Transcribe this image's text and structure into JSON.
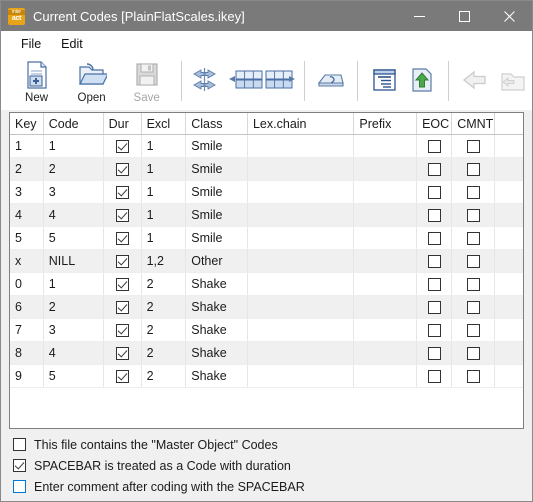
{
  "window": {
    "title": "Current Codes [PlainFlatScales.ikey]",
    "app_icon": "interact-app-icon",
    "app_icon_line1": "inter",
    "app_icon_line2": "act",
    "minimize_label": "Minimize",
    "maximize_label": "Maximize",
    "close_label": "Close",
    "accent_icon_color": "#e8a317",
    "titlebar_color": "#7a7a7a"
  },
  "menubar": {
    "items": [
      {
        "label": "File"
      },
      {
        "label": "Edit"
      }
    ]
  },
  "toolbar": {
    "buttons": [
      {
        "label": "New",
        "icon": "new-document-icon",
        "enabled": true
      },
      {
        "label": "Open",
        "icon": "open-folder-icon",
        "enabled": true
      },
      {
        "label": "Save",
        "icon": "floppy-disk-save-icon",
        "enabled": false
      }
    ],
    "tools": [
      {
        "label": "",
        "icon": "move-columns-arrows-icon",
        "enabled": true
      },
      {
        "label": "",
        "icon": "insert-columns-icon",
        "enabled": true
      },
      {
        "label": "",
        "icon": "keyboard-key-icon",
        "enabled": true
      },
      {
        "label": "",
        "icon": "list-properties-icon",
        "enabled": true
      },
      {
        "label": "",
        "icon": "export-up-arrow-icon",
        "enabled": true
      },
      {
        "label": "",
        "icon": "back-arrow-icon",
        "enabled": false
      },
      {
        "label": "",
        "icon": "folder-back-icon",
        "enabled": false
      }
    ]
  },
  "grid": {
    "columns": [
      {
        "label": "Key",
        "width": "7.0%"
      },
      {
        "label": "Code",
        "width": "12.6%"
      },
      {
        "label": "Dur",
        "width": "8.0%"
      },
      {
        "label": "Excl",
        "width": "9.4%"
      },
      {
        "label": "Class",
        "width": "13.0%"
      },
      {
        "label": "Lex.chain",
        "width": "22.4%"
      },
      {
        "label": "Prefix",
        "width": "13.2%"
      },
      {
        "label": "EOC",
        "width": "7.4%"
      },
      {
        "label": "CMNT",
        "width": "9.0%"
      },
      {
        "label": "",
        "width": "6.0%"
      }
    ],
    "rows": [
      {
        "key": "1",
        "code": "1",
        "dur": true,
        "excl": "1",
        "class": "Smile",
        "lexchain": "",
        "prefix": "",
        "eoc": false,
        "cmnt": false
      },
      {
        "key": "2",
        "code": "2",
        "dur": true,
        "excl": "1",
        "class": "Smile",
        "lexchain": "",
        "prefix": "",
        "eoc": false,
        "cmnt": false
      },
      {
        "key": "3",
        "code": "3",
        "dur": true,
        "excl": "1",
        "class": "Smile",
        "lexchain": "",
        "prefix": "",
        "eoc": false,
        "cmnt": false
      },
      {
        "key": "4",
        "code": "4",
        "dur": true,
        "excl": "1",
        "class": "Smile",
        "lexchain": "",
        "prefix": "",
        "eoc": false,
        "cmnt": false
      },
      {
        "key": "5",
        "code": "5",
        "dur": true,
        "excl": "1",
        "class": "Smile",
        "lexchain": "",
        "prefix": "",
        "eoc": false,
        "cmnt": false
      },
      {
        "key": "x",
        "code": "NILL",
        "dur": true,
        "excl": "1,2",
        "class": "Other",
        "lexchain": "",
        "prefix": "",
        "eoc": false,
        "cmnt": false
      },
      {
        "key": "0",
        "code": "1",
        "dur": true,
        "excl": "2",
        "class": "Shake",
        "lexchain": "",
        "prefix": "",
        "eoc": false,
        "cmnt": false
      },
      {
        "key": "6",
        "code": "2",
        "dur": true,
        "excl": "2",
        "class": "Shake",
        "lexchain": "",
        "prefix": "",
        "eoc": false,
        "cmnt": false
      },
      {
        "key": "7",
        "code": "3",
        "dur": true,
        "excl": "2",
        "class": "Shake",
        "lexchain": "",
        "prefix": "",
        "eoc": false,
        "cmnt": false
      },
      {
        "key": "8",
        "code": "4",
        "dur": true,
        "excl": "2",
        "class": "Shake",
        "lexchain": "",
        "prefix": "",
        "eoc": false,
        "cmnt": false
      },
      {
        "key": "9",
        "code": "5",
        "dur": true,
        "excl": "2",
        "class": "Shake",
        "lexchain": "",
        "prefix": "",
        "eoc": false,
        "cmnt": false
      }
    ]
  },
  "options": [
    {
      "label": "This file contains the \"Master Object\" Codes",
      "checked": false,
      "focused": false
    },
    {
      "label": "SPACEBAR is treated as a Code with duration",
      "checked": true,
      "focused": false
    },
    {
      "label": "Enter comment after coding with the SPACEBAR",
      "checked": false,
      "focused": true
    }
  ]
}
